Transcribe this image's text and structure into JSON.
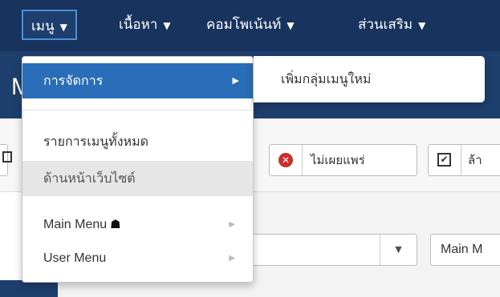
{
  "nav": {
    "items": [
      {
        "label": "เมนู",
        "caret": "▼"
      },
      {
        "label": "เนื้อหา",
        "caret": "▼"
      },
      {
        "label": "คอมโพเน้นท์",
        "caret": "▼"
      },
      {
        "label": "ส่วนเสริม",
        "caret": "▼"
      }
    ]
  },
  "header": {
    "title_fragment": "M"
  },
  "toolbar": {
    "unpublish_label": "ไม่เผยแพร่",
    "unpublish_icon": "✕",
    "checkin_label": "ล้า",
    "checkin_icon": "✔"
  },
  "filters": {
    "menu_select_value": "Main M",
    "select_arrow": "▼"
  },
  "dropdown": {
    "manage_label": "การจัดการ",
    "manage_chevron": "▶",
    "all_menus_label": "รายการเมนูทั้งหมด",
    "site_label": "ด้านหน้าเว็บไซต์",
    "main_menu_label": "Main Menu",
    "main_menu_icon": "☗",
    "user_menu_label": "User Menu",
    "sub_chevron": "▶"
  },
  "submenu": {
    "add_group_label": "เพิ่มกลุ่มเมนูใหม่"
  },
  "colors": {
    "nav_bg": "#17335e",
    "header_bg": "#1e3f6e",
    "active": "#2a6db8",
    "danger": "#c9302c"
  }
}
